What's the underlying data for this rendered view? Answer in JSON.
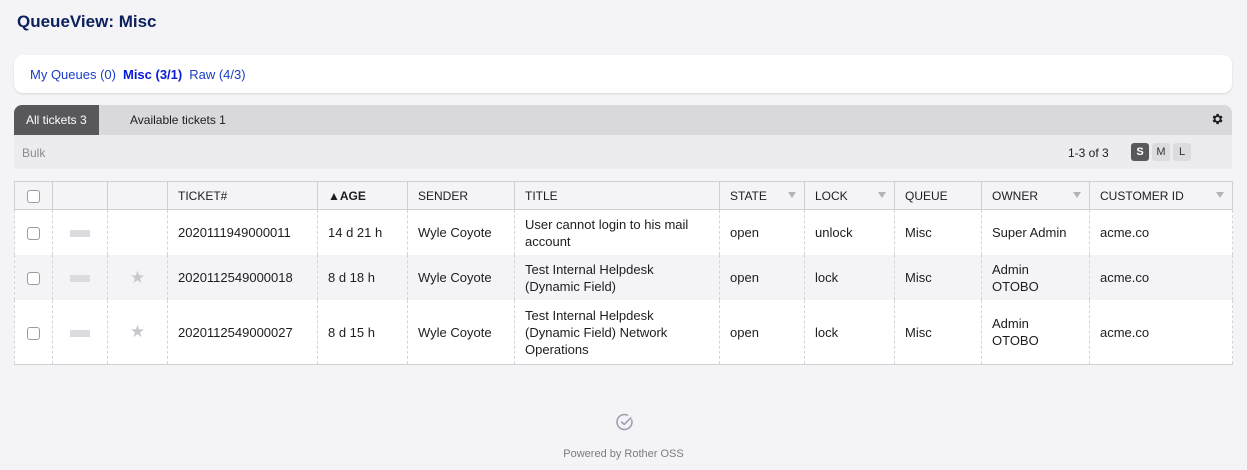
{
  "page": {
    "title": "QueueView: Misc"
  },
  "queues": [
    {
      "label": "My Queues (0)"
    },
    {
      "label": "Misc (3/1)"
    },
    {
      "label": "Raw (4/3)"
    }
  ],
  "tabs": {
    "all": "All tickets 3",
    "available": "Available tickets 1"
  },
  "toolbar": {
    "bulk": "Bulk",
    "pager": "1-3 of 3",
    "sizes": [
      "S",
      "M",
      "L"
    ]
  },
  "icons": {
    "settings": "gear-icon",
    "footer": "check-circle-icon",
    "star": "star-icon"
  },
  "table": {
    "headers": {
      "ticket": "TICKET#",
      "age": "▲AGE",
      "sender": "SENDER",
      "title": "TITLE",
      "state": "STATE",
      "lock": "LOCK",
      "queue": "QUEUE",
      "owner": "OWNER",
      "customer": "CUSTOMER ID"
    },
    "rows": [
      {
        "ticket": "2020111949000011",
        "age": "14 d 21 h",
        "sender": "Wyle Coyote",
        "title": "User cannot login to his mail account",
        "state": "open",
        "lock": "unlock",
        "queue": "Misc",
        "owner": "Super Admin",
        "customer": "acme.co"
      },
      {
        "ticket": "2020112549000018",
        "age": "8 d 18 h",
        "sender": "Wyle Coyote",
        "title": "Test Internal Helpdesk (Dynamic Field)",
        "state": "open",
        "lock": "lock",
        "queue": "Misc",
        "owner": "Admin OTOBO",
        "customer": "acme.co"
      },
      {
        "ticket": "2020112549000027",
        "age": "8 d 15 h",
        "sender": "Wyle Coyote",
        "title": "Test Internal Helpdesk (Dynamic Field) Network Operations",
        "state": "open",
        "lock": "lock",
        "queue": "Misc",
        "owner": "Admin OTOBO",
        "customer": "acme.co"
      }
    ]
  },
  "footer": {
    "text": "Powered by Rother OSS"
  },
  "colors": {
    "accent": "#1a3cc7",
    "title": "#0a1f5c",
    "tab_active": "#58585c"
  }
}
